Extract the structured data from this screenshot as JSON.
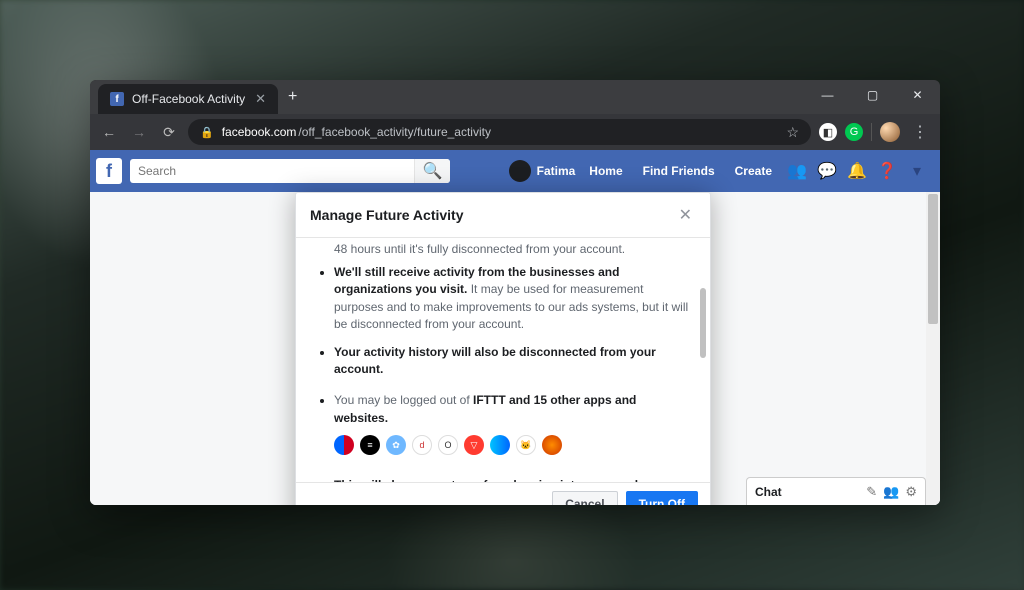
{
  "browser": {
    "tab_title": "Off-Facebook Activity",
    "new_tab_glyph": "+",
    "window_controls": {
      "min": "—",
      "max": "▢",
      "close": "✕"
    },
    "nav": {
      "back": "←",
      "forward": "→",
      "reload": "⟳"
    },
    "addressbar": {
      "lock": "🔒",
      "host": "facebook.com",
      "path": "/off_facebook_activity/future_activity",
      "star": "☆"
    },
    "menu_glyph": "⋮"
  },
  "fb": {
    "logo_glyph": "f",
    "search_placeholder": "Search",
    "search_icon": "🔍",
    "profile_name": "Fatima",
    "nav": {
      "home": "Home",
      "find_friends": "Find Friends",
      "create": "Create"
    },
    "icons": {
      "friends": "👥",
      "messages": "💬",
      "notifications": "🔔",
      "help": "❓",
      "dropdown": "▾"
    }
  },
  "modal": {
    "title": "Manage Future Activity",
    "close_glyph": "✕",
    "frag_top": "48 hours until it's fully disconnected from your account.",
    "bullet1_bold": "We'll still receive activity from the businesses and organizations you visit.",
    "bullet1_rest": " It may be used for measurement purposes and to make improvements to our ads systems, but it will be disconnected from your account.",
    "bullet2": "Your activity history will also be disconnected from your account.",
    "bullet3_lead": "You may be logged out of ",
    "bullet3_bold": "IFTTT and 15 other apps and websites.",
    "bullet4": "This will also prevent you from logging into apps and websites with Facebook because your activity will be disconnected",
    "cancel_label": "Cancel",
    "confirm_label": "Turn Off",
    "app_icons": [
      {
        "bg": "linear-gradient(90deg,#0066ff 50%,#d00020 50%)"
      },
      {
        "bg": "#000",
        "glyph": "≡",
        "color": "#fff"
      },
      {
        "bg": "#6fb8ff",
        "glyph": "✿",
        "color": "#fff"
      },
      {
        "bg": "#fff",
        "glyph": "d",
        "color": "#c33",
        "border": "1px solid #ddd"
      },
      {
        "bg": "#fff",
        "glyph": "O",
        "color": "#333",
        "border": "1px solid #ddd"
      },
      {
        "bg": "#ff3b30",
        "glyph": "▽",
        "color": "#fff"
      },
      {
        "bg": "linear-gradient(90deg,#00c3ff,#0066ff)"
      },
      {
        "bg": "#fff",
        "glyph": "🐱",
        "border": "1px solid #ddd"
      },
      {
        "bg": "radial-gradient(circle,#ff8c00,#cc3300)"
      }
    ]
  },
  "chat": {
    "label": "Chat",
    "compose": "✎",
    "group": "👥",
    "settings": "⚙"
  }
}
